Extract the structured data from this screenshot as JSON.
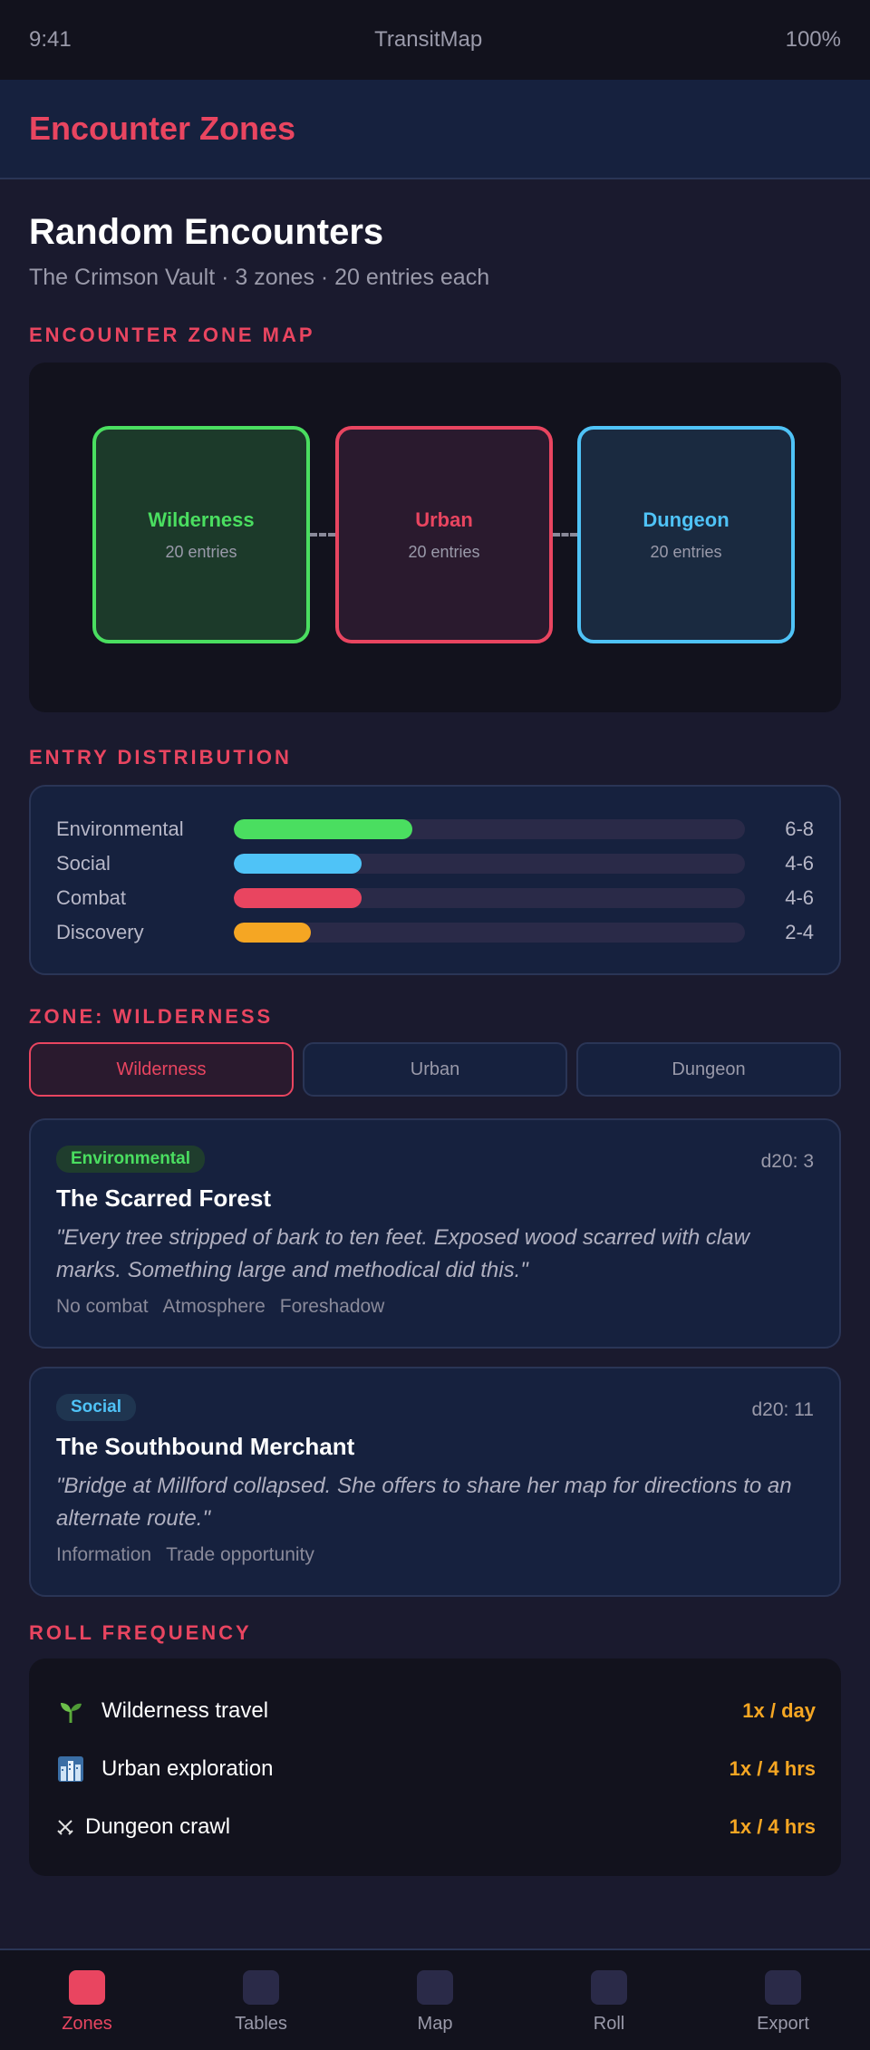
{
  "status_bar": {
    "time": "9:41",
    "title": "TransitMap",
    "battery": "100%"
  },
  "header": {
    "title": "Encounter Zones"
  },
  "page": {
    "title": "Random Encounters",
    "subtitle": "The Crimson Vault · 3 zones · 20 entries each"
  },
  "zone_map": {
    "label": "Encounter Zone Map",
    "zones": [
      {
        "name": "Wilderness",
        "count": "20 entries",
        "color": "#4ade60"
      },
      {
        "name": "Urban",
        "count": "20 entries",
        "color": "#e94560"
      },
      {
        "name": "Dungeon",
        "count": "20 entries",
        "color": "#4fc3f7"
      }
    ]
  },
  "distribution": {
    "label": "Entry Distribution",
    "rows": [
      {
        "name": "Environmental",
        "range": "6-8",
        "fill": 0.35,
        "color": "#4ade60"
      },
      {
        "name": "Social",
        "range": "4-6",
        "fill": 0.25,
        "color": "#4fc3f7"
      },
      {
        "name": "Combat",
        "range": "4-6",
        "fill": 0.25,
        "color": "#e94560"
      },
      {
        "name": "Discovery",
        "range": "2-4",
        "fill": 0.15,
        "color": "#f5a623"
      }
    ]
  },
  "zone_section": {
    "label": "Zone: Wilderness",
    "tabs": [
      "Wilderness",
      "Urban",
      "Dungeon"
    ],
    "active_tab": "Wilderness"
  },
  "entries": [
    {
      "category": "Environmental",
      "roll": "d20: 3",
      "title": "The Scarred Forest",
      "quote": "\"Every tree stripped of bark to ten feet. Exposed wood scarred with claw marks. Something large and methodical did this.\"",
      "tags": [
        "No combat",
        "Atmosphere",
        "Foreshadow"
      ]
    },
    {
      "category": "Social",
      "roll": "d20: 11",
      "title": "The Southbound Merchant",
      "quote": "\"Bridge at Millford collapsed. She offers to share her map for directions to an alternate route.\"",
      "tags": [
        "Information",
        "Trade opportunity"
      ]
    }
  ],
  "roll_frequency": {
    "label": "Roll Frequency",
    "rows": [
      {
        "icon": "seedling-icon",
        "label": "Wilderness travel",
        "value": "1x / day"
      },
      {
        "icon": "cityscape-icon",
        "label": "Urban exploration",
        "value": "1x / 4 hrs"
      },
      {
        "icon": "crossed-swords-icon",
        "label": "Dungeon crawl",
        "value": "1x / 4 hrs"
      }
    ]
  },
  "tab_bar": {
    "items": [
      "Zones",
      "Tables",
      "Map",
      "Roll",
      "Export"
    ],
    "active": "Zones"
  },
  "colors": {
    "accent": "#e94560",
    "value": "#f5a623"
  }
}
